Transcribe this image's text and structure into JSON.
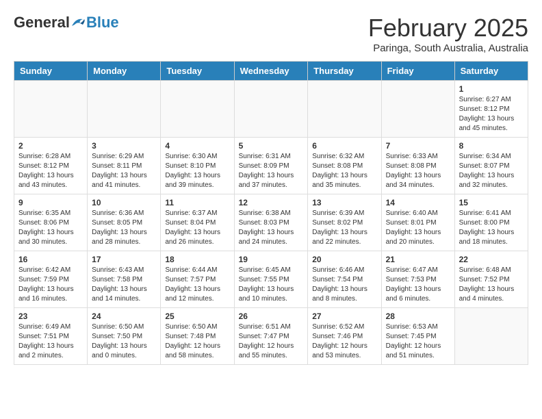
{
  "header": {
    "logo_general": "General",
    "logo_blue": "Blue",
    "month_year": "February 2025",
    "location": "Paringa, South Australia, Australia"
  },
  "weekdays": [
    "Sunday",
    "Monday",
    "Tuesday",
    "Wednesday",
    "Thursday",
    "Friday",
    "Saturday"
  ],
  "weeks": [
    [
      {
        "day": "",
        "info": ""
      },
      {
        "day": "",
        "info": ""
      },
      {
        "day": "",
        "info": ""
      },
      {
        "day": "",
        "info": ""
      },
      {
        "day": "",
        "info": ""
      },
      {
        "day": "",
        "info": ""
      },
      {
        "day": "1",
        "info": "Sunrise: 6:27 AM\nSunset: 8:12 PM\nDaylight: 13 hours\nand 45 minutes."
      }
    ],
    [
      {
        "day": "2",
        "info": "Sunrise: 6:28 AM\nSunset: 8:12 PM\nDaylight: 13 hours\nand 43 minutes."
      },
      {
        "day": "3",
        "info": "Sunrise: 6:29 AM\nSunset: 8:11 PM\nDaylight: 13 hours\nand 41 minutes."
      },
      {
        "day": "4",
        "info": "Sunrise: 6:30 AM\nSunset: 8:10 PM\nDaylight: 13 hours\nand 39 minutes."
      },
      {
        "day": "5",
        "info": "Sunrise: 6:31 AM\nSunset: 8:09 PM\nDaylight: 13 hours\nand 37 minutes."
      },
      {
        "day": "6",
        "info": "Sunrise: 6:32 AM\nSunset: 8:08 PM\nDaylight: 13 hours\nand 35 minutes."
      },
      {
        "day": "7",
        "info": "Sunrise: 6:33 AM\nSunset: 8:08 PM\nDaylight: 13 hours\nand 34 minutes."
      },
      {
        "day": "8",
        "info": "Sunrise: 6:34 AM\nSunset: 8:07 PM\nDaylight: 13 hours\nand 32 minutes."
      }
    ],
    [
      {
        "day": "9",
        "info": "Sunrise: 6:35 AM\nSunset: 8:06 PM\nDaylight: 13 hours\nand 30 minutes."
      },
      {
        "day": "10",
        "info": "Sunrise: 6:36 AM\nSunset: 8:05 PM\nDaylight: 13 hours\nand 28 minutes."
      },
      {
        "day": "11",
        "info": "Sunrise: 6:37 AM\nSunset: 8:04 PM\nDaylight: 13 hours\nand 26 minutes."
      },
      {
        "day": "12",
        "info": "Sunrise: 6:38 AM\nSunset: 8:03 PM\nDaylight: 13 hours\nand 24 minutes."
      },
      {
        "day": "13",
        "info": "Sunrise: 6:39 AM\nSunset: 8:02 PM\nDaylight: 13 hours\nand 22 minutes."
      },
      {
        "day": "14",
        "info": "Sunrise: 6:40 AM\nSunset: 8:01 PM\nDaylight: 13 hours\nand 20 minutes."
      },
      {
        "day": "15",
        "info": "Sunrise: 6:41 AM\nSunset: 8:00 PM\nDaylight: 13 hours\nand 18 minutes."
      }
    ],
    [
      {
        "day": "16",
        "info": "Sunrise: 6:42 AM\nSunset: 7:59 PM\nDaylight: 13 hours\nand 16 minutes."
      },
      {
        "day": "17",
        "info": "Sunrise: 6:43 AM\nSunset: 7:58 PM\nDaylight: 13 hours\nand 14 minutes."
      },
      {
        "day": "18",
        "info": "Sunrise: 6:44 AM\nSunset: 7:57 PM\nDaylight: 13 hours\nand 12 minutes."
      },
      {
        "day": "19",
        "info": "Sunrise: 6:45 AM\nSunset: 7:55 PM\nDaylight: 13 hours\nand 10 minutes."
      },
      {
        "day": "20",
        "info": "Sunrise: 6:46 AM\nSunset: 7:54 PM\nDaylight: 13 hours\nand 8 minutes."
      },
      {
        "day": "21",
        "info": "Sunrise: 6:47 AM\nSunset: 7:53 PM\nDaylight: 13 hours\nand 6 minutes."
      },
      {
        "day": "22",
        "info": "Sunrise: 6:48 AM\nSunset: 7:52 PM\nDaylight: 13 hours\nand 4 minutes."
      }
    ],
    [
      {
        "day": "23",
        "info": "Sunrise: 6:49 AM\nSunset: 7:51 PM\nDaylight: 13 hours\nand 2 minutes."
      },
      {
        "day": "24",
        "info": "Sunrise: 6:50 AM\nSunset: 7:50 PM\nDaylight: 13 hours\nand 0 minutes."
      },
      {
        "day": "25",
        "info": "Sunrise: 6:50 AM\nSunset: 7:48 PM\nDaylight: 12 hours\nand 58 minutes."
      },
      {
        "day": "26",
        "info": "Sunrise: 6:51 AM\nSunset: 7:47 PM\nDaylight: 12 hours\nand 55 minutes."
      },
      {
        "day": "27",
        "info": "Sunrise: 6:52 AM\nSunset: 7:46 PM\nDaylight: 12 hours\nand 53 minutes."
      },
      {
        "day": "28",
        "info": "Sunrise: 6:53 AM\nSunset: 7:45 PM\nDaylight: 12 hours\nand 51 minutes."
      },
      {
        "day": "",
        "info": ""
      }
    ]
  ]
}
